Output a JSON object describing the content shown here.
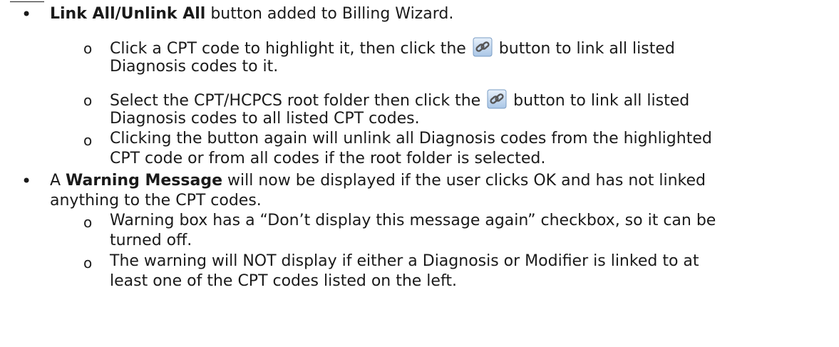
{
  "items": [
    {
      "bold": "Link All/Unlink All",
      "text": " button added to Billing Wizard."
    },
    {
      "sub": [
        {
          "l1_pre": "Click a CPT code to highlight it, then click the ",
          "l1_post": " button to link all listed",
          "l2": "Diagnosis codes to it."
        },
        {
          "l1_pre": "Select the CPT/HCPCS root folder then click the ",
          "l1_post": " button to link all listed",
          "l2": "Diagnosis codes to all listed CPT codes."
        },
        {
          "l1": "Clicking the button again will unlink all Diagnosis codes from the highlighted",
          "l2": "CPT code or from all codes if the root folder is selected."
        }
      ]
    },
    {
      "pre": "A ",
      "bold": "Warning Message",
      "text": " will now be displayed if the user clicks OK and has not linked",
      "l2": "anything to the CPT codes."
    },
    {
      "sub": [
        {
          "l1": "Warning box has a “Don’t display this message again” checkbox, so it can be",
          "l2": "turned off."
        },
        {
          "l1": "The warning will NOT display if either a Diagnosis or Modifier is linked to at",
          "l2": "least one of the CPT codes listed on the left."
        }
      ]
    }
  ],
  "bullet_glyph": "•",
  "sub_bullet_glyph": "o",
  "icon": "link-chain-icon"
}
